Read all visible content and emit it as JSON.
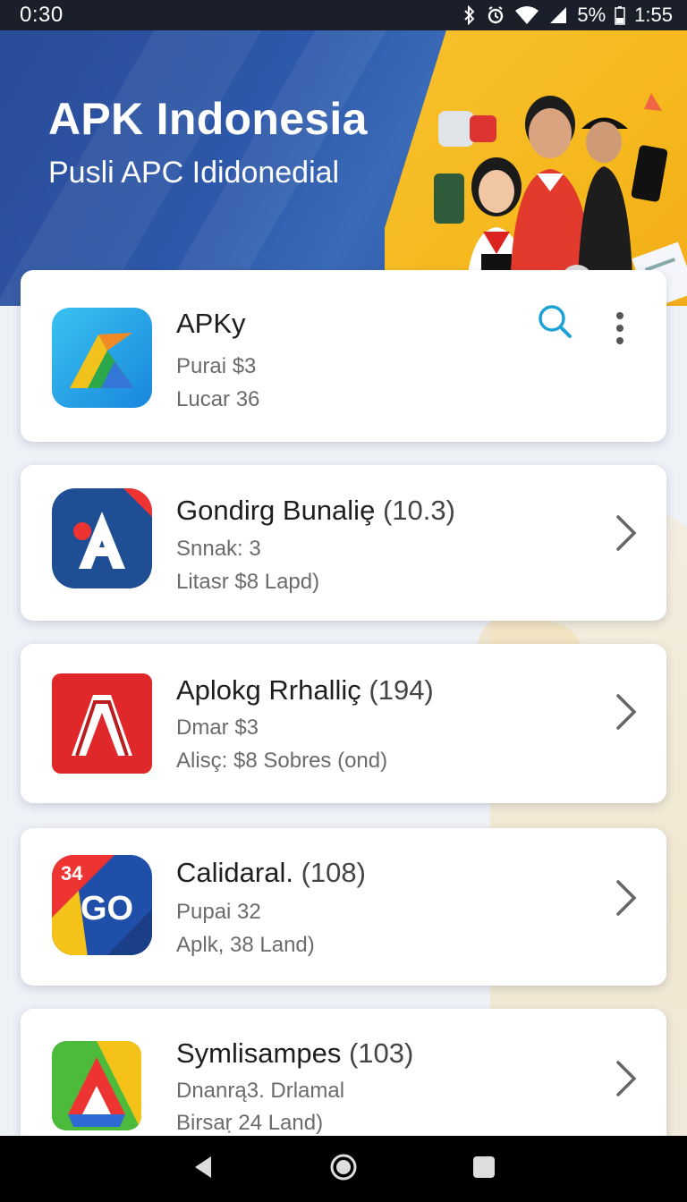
{
  "status_bar": {
    "time_left": "0:30",
    "battery": "5%",
    "time_right": "1:55"
  },
  "hero": {
    "title": "APK Indonesia",
    "subtitle": "Pusli APC Ididonedial"
  },
  "apps": [
    {
      "name": "APKy",
      "count": "",
      "line1": "Purai $3",
      "line2": "Lucar 36"
    },
    {
      "name": "Gondirg Bunaliȩ",
      "count": "(10.3)",
      "line1": "Snnak: 3",
      "line2": "Litasr $8  Lapd)"
    },
    {
      "name": "Aplokg Rrhalliç",
      "count": "(194)",
      "line1": "Dmar $3",
      "line2": "Alisç: $8  Sobres  (ond)"
    },
    {
      "name": "Calidaral.",
      "count": "(108)",
      "line1": "Pupai 32",
      "line2": "Aplk, 38  Land)"
    },
    {
      "name": "Symlisampes",
      "count": "(103)",
      "line1": "Dnanrą3.  Drlamal",
      "line2": "Birsaṛ 24  Land)"
    }
  ],
  "icon_badges": {
    "calendar_number": "34",
    "go_text": "GO"
  },
  "colors": {
    "hero_blue": "#2a4b97",
    "hero_yellow": "#f8c12f",
    "search_accent": "#1ea1d6"
  }
}
